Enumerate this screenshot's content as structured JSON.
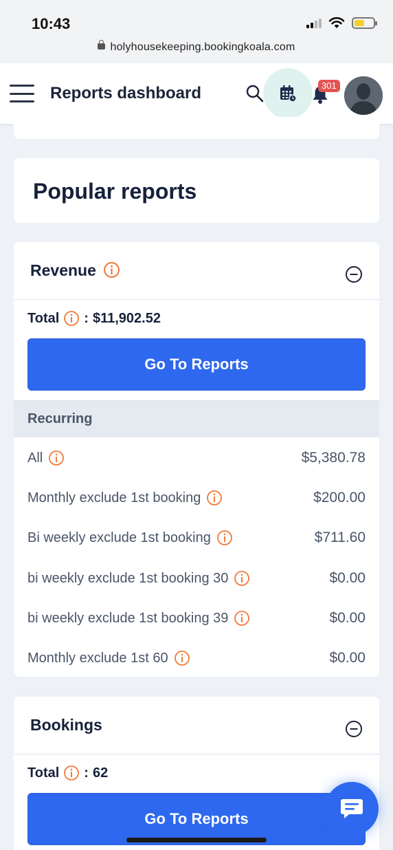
{
  "status_bar": {
    "time": "10:43",
    "url": "holyhousekeeping.bookingkoala.com"
  },
  "header": {
    "title": "Reports dashboard",
    "notification_count": "301",
    "accent_color": "#dff2ef"
  },
  "popular": {
    "title": "Popular reports"
  },
  "revenue": {
    "title": "Revenue",
    "total_label": "Total",
    "total_separator": ":",
    "total_value": "$11,902.52",
    "button_label": "Go To Reports",
    "subsection_title": "Recurring",
    "rows": [
      {
        "label": "All",
        "value": "$5,380.78"
      },
      {
        "label": "Monthly exclude 1st booking",
        "value": "$200.00"
      },
      {
        "label": "Bi weekly exclude 1st booking",
        "value": "$711.60"
      },
      {
        "label": "bi weekly exclude 1st booking 30",
        "value": "$0.00"
      },
      {
        "label": "bi weekly exclude 1st booking 39",
        "value": "$0.00"
      },
      {
        "label": "Monthly exclude 1st 60",
        "value": "$0.00"
      }
    ]
  },
  "bookings": {
    "title": "Bookings",
    "total_label": "Total",
    "total_separator": ":",
    "total_value": "62",
    "button_label": "Go To Reports"
  },
  "colors": {
    "primary": "#2e68ee",
    "info_icon": "#f07a3a",
    "badge": "#e35454"
  }
}
